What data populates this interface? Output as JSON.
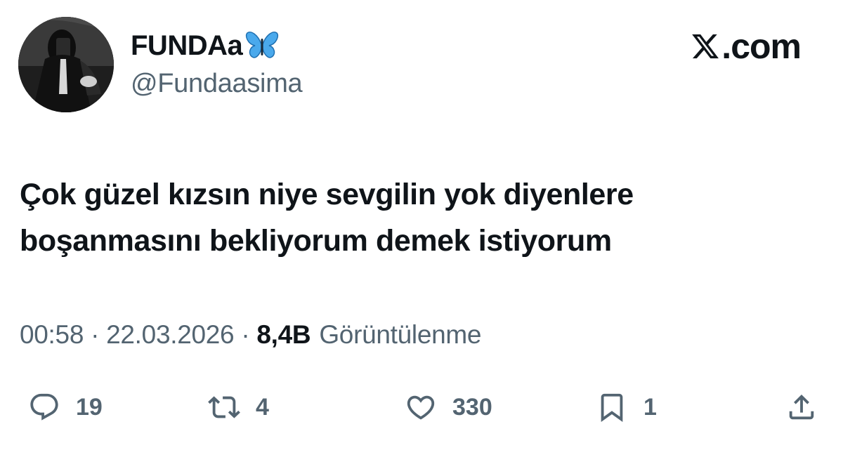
{
  "author": {
    "display_name": "FUNDAa",
    "handle": "@Fundaasima",
    "name_emoji": "butterfly-icon"
  },
  "brand": {
    "logo_icon": "x-logo-icon",
    "text": ".com"
  },
  "tweet": {
    "lines": [
      "Çok güzel kızsın niye sevgilin yok diyenlere",
      "boşanmasını bekliyorum demek istiyorum"
    ]
  },
  "meta": {
    "time": "00:58",
    "separator": "·",
    "date": "22.03.2026",
    "views_count": "8,4B",
    "views_label": "Görüntülenme"
  },
  "actions": {
    "reply": {
      "icon": "reply-icon",
      "count": "19"
    },
    "retweet": {
      "icon": "retweet-icon",
      "count": "4"
    },
    "like": {
      "icon": "heart-icon",
      "count": "330"
    },
    "bookmark": {
      "icon": "bookmark-icon",
      "count": "1"
    },
    "share": {
      "icon": "share-icon"
    }
  },
  "colors": {
    "text_primary": "#0f1419",
    "text_secondary": "#536471",
    "butterfly": "#4aa9ec"
  }
}
